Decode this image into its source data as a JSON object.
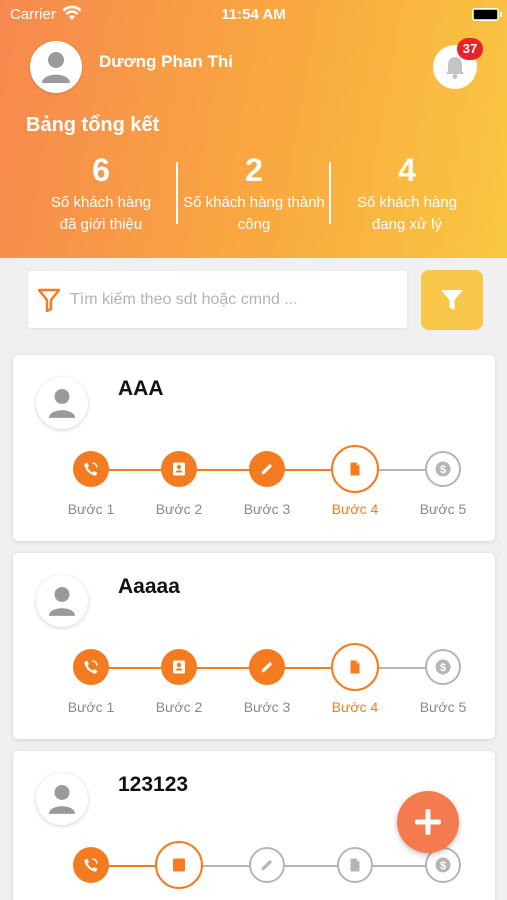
{
  "status_bar": {
    "carrier": "Carrier",
    "time": "11:54 AM"
  },
  "header": {
    "user_name": "Dương Phan Thi",
    "notification_count": "37",
    "summary_title": "Bảng tổng kết",
    "stats": [
      {
        "value": "6",
        "label_line1": "Số khách hàng",
        "label_line2": "đã giới thiệu"
      },
      {
        "value": "2",
        "label_line1": "Số khách hàng thành",
        "label_line2": "công"
      },
      {
        "value": "4",
        "label_line1": "Số khách hàng",
        "label_line2": "đang xử lý"
      }
    ]
  },
  "search": {
    "placeholder": "Tìm kiếm theo sdt hoặc cmnd ..."
  },
  "step_labels": [
    "Bước 1",
    "Bước 2",
    "Bước 3",
    "Bước 4",
    "Bước 5"
  ],
  "step_icons": [
    "phone-icon",
    "contact-card-icon",
    "pencil-icon",
    "document-icon",
    "dollar-coin-icon"
  ],
  "customers": [
    {
      "name": "AAA",
      "current_step": 4
    },
    {
      "name": "Aaaaa",
      "current_step": 4
    },
    {
      "name": "123123",
      "current_step": 2
    }
  ],
  "colors": {
    "accent": "#f47b20",
    "pending": "#b5b5b5",
    "filter_button": "#f8c74a",
    "fab": "#f47b4f",
    "badge": "#e8232b"
  }
}
